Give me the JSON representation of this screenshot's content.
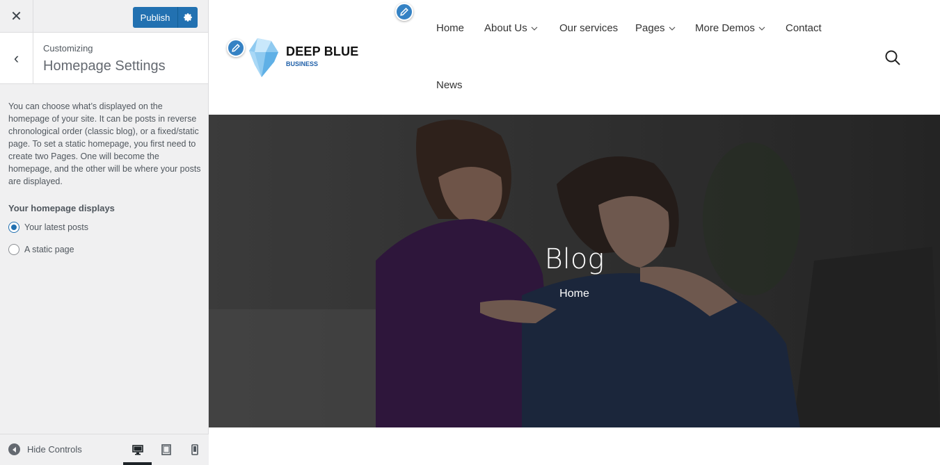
{
  "sidebar": {
    "close_label": "✕",
    "publish_label": "Publish",
    "back_label": "‹",
    "customizing_label": "Customizing",
    "section_title": "Homepage Settings",
    "description": "You can choose what’s displayed on the homepage of your site. It can be posts in reverse chronological order (classic blog), or a fixed/static page. To set a static homepage, you first need to create two Pages. One will become the homepage, and the other will be where your posts are displayed.",
    "homepage_displays_label": "Your homepage displays",
    "options": [
      {
        "label": "Your latest posts",
        "checked": true
      },
      {
        "label": "A static page",
        "checked": false
      }
    ],
    "hide_controls_label": "Hide Controls",
    "devices": [
      "desktop-icon",
      "tablet-icon",
      "mobile-icon"
    ],
    "active_device": "desktop"
  },
  "site": {
    "title": "DEEP BLUE",
    "tagline": "BUSINESS",
    "nav": [
      {
        "label": "Home",
        "dropdown": false
      },
      {
        "label": "About Us",
        "dropdown": true
      },
      {
        "label": "Our services",
        "dropdown": false
      },
      {
        "label": "Pages",
        "dropdown": true
      },
      {
        "label": "More Demos",
        "dropdown": true
      },
      {
        "label": "Contact",
        "dropdown": false
      },
      {
        "label": "News",
        "dropdown": false
      }
    ]
  },
  "hero": {
    "title": "Blog",
    "breadcrumb": "Home"
  },
  "colors": {
    "accent": "#2271b1",
    "pencil": "#3582c4",
    "brand_blue": "#1e5fa8"
  }
}
